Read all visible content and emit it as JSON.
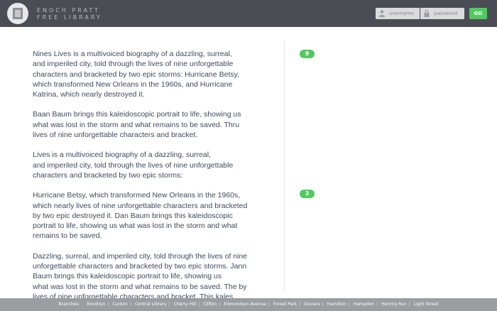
{
  "header": {
    "brand_line1": "ENOCH PRATT",
    "brand_line2": "FREE LIBRARY",
    "username_placeholder": "username",
    "password_placeholder": "password",
    "go_label": "GO"
  },
  "article": {
    "paragraphs": [
      "Nines Lives is a multivoiced biography of a dazzling, surreal,\nand imperiled city, told through the lives of nine unforgettable\ncharacters and bracketed by two epic storms: Hurricane Betsy,\nwhich transformed New Orleans in the 1960s, and Hurricane\nKatrina, which nearly destroyed it.",
      "Baan Baum brings this kaleidoscopic portrait to life, showing us\nwhat was lost in the storm and what remains to be saved. Thru\nlives of nine unforgettable characters and bracket.",
      "Lives is a multivoiced biography of a dazzling, surreal,\nand imperiled city, told through the lives of nine unforgettable\ncharacters and bracketed by two epic storms:",
      "Hurricane Betsy, which transformed New Orleans in the 1960s,\nwhich nearly  lives of nine unforgettable characters and bracketed\nby two epic destroyed it. Dan Baum brings this kaleidoscopic\nportrait to life, showing us what was lost in the storm and what\nremains to be saved.",
      "Dazzling, surreal, and imperiled city, told through the lives of nine\nunforgettable characters and bracketed by two epic storms. Jann\nBaum brings this kaleidoscopic portrait to life, showing us\nwhat was lost in the storm and what remains to be saved. The by\nlives of nine unforgettable characters and bracket. This kales idosco"
    ]
  },
  "annotations": {
    "badge_1": "9",
    "badge_2": "3"
  },
  "footer": {
    "label": "Branches:",
    "branches": [
      "Brooklyn",
      "Canton",
      "Central Library",
      "Cherry Hill",
      "Clifton",
      "Edmondson Avenue",
      "Forest Park",
      "Govans",
      "Hamilton",
      "Hampden",
      "Herring Run",
      "Light Street"
    ]
  },
  "colors": {
    "header_bg": "#4a4d53",
    "accent_green": "#52c95f",
    "footer_bg": "#9a9da2",
    "body_text": "#3d4a5c"
  },
  "icons": {
    "logo": "book-icon",
    "username": "user-icon",
    "password": "lock-icon"
  }
}
